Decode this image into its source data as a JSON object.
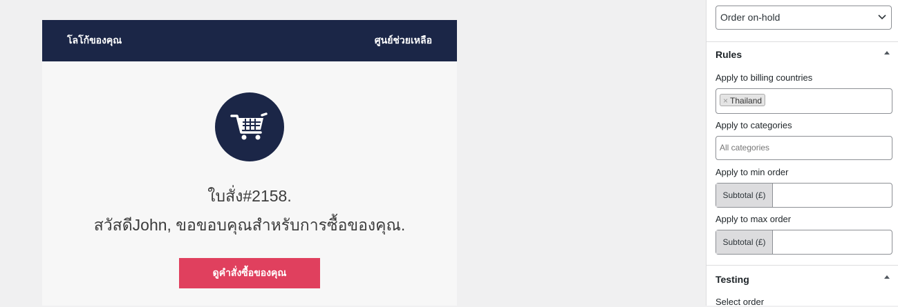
{
  "email": {
    "header_left": "โลโก้ของคุณ",
    "header_right": "ศูนย์ช่วยเหลือ",
    "cart_icon": "shopping-cart-icon",
    "title": "ใบสั่ง#2158.",
    "subtitle": "สวัสดีJohn, ขอขอบคุณสำหรับการซื้อของคุณ.",
    "button_label": "ดูคำสั่งซื้อของคุณ",
    "colors": {
      "header": "#1b2647",
      "button": "#e0405e"
    }
  },
  "sidebar": {
    "status_select": "Order on-hold",
    "rules": {
      "title": "Rules",
      "billing_label": "Apply to billing countries",
      "billing_tag": "Thailand",
      "categories_label": "Apply to categories",
      "categories_placeholder": "All categories",
      "min_label": "Apply to min order",
      "min_prefix": "Subtotal (£)",
      "max_label": "Apply to max order",
      "max_prefix": "Subtotal (£)"
    },
    "testing": {
      "title": "Testing",
      "select_order_label": "Select order"
    }
  }
}
